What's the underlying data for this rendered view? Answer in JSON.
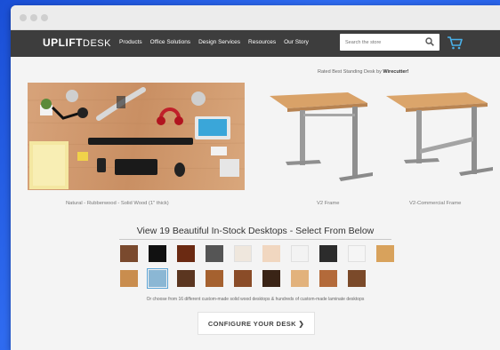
{
  "brand": {
    "logo_primary": "UPLIFT",
    "logo_secondary": "DESK"
  },
  "nav": {
    "items": [
      "Products",
      "Office Solutions",
      "Design Services",
      "Resources",
      "Our Story"
    ],
    "search_placeholder": "Search the store",
    "cart_icon": "cart-icon"
  },
  "hero": {
    "rated_prefix": "Rated Best Standing Desk by",
    "rated_source": "Wirecutter!",
    "photo_caption": "Natural - Rubberwood - Solid Wood (1\" thick)",
    "frame_captions": [
      "V2 Frame",
      "V2-Commercial Frame"
    ]
  },
  "desktops": {
    "headline": "View 19 Beautiful In-Stock Desktops - Select From Below",
    "subtext": "Or choose from 16 different custom-made solid wood desktops & hundreds of custom-made laminate desktops",
    "swatch_colors_row1": [
      "#7a4a2e",
      "#111111",
      "#6b2a12",
      "#555555",
      "#efe7dd",
      "#f1d7c0",
      "#f3f3f3",
      "#2c2c2c",
      "#f5f5f5",
      "#d8a25c"
    ],
    "swatch_colors_row2": [
      "#c98d4e",
      "#8bb7d4",
      "#5b3620",
      "#a5612f",
      "#8a4c28",
      "#3a2416",
      "#e2b27c",
      "#b36a3a",
      "#7b4a2a"
    ],
    "selected_index_row2": 1
  },
  "cta": {
    "label": "CONFIGURE YOUR DESK ❯"
  }
}
